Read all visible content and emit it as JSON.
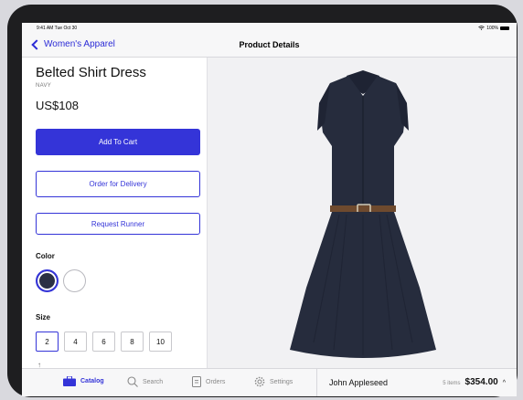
{
  "status": {
    "time": "9:41 AM  Tue Oct 30",
    "battery": "100%"
  },
  "nav": {
    "back_label": "Women's Apparel",
    "title": "Product Details"
  },
  "product": {
    "name": "Belted Shirt Dress",
    "variant": "NAVY",
    "price": "US$108",
    "actions": {
      "add_to_cart": "Add To Cart",
      "delivery": "Order for Delivery",
      "runner": "Request Runner"
    },
    "color_label": "Color",
    "colors": [
      {
        "name": "navy",
        "hex": "#2b3044",
        "selected": true
      },
      {
        "name": "white",
        "hex": "#ffffff",
        "selected": false
      }
    ],
    "size_label": "Size",
    "sizes": [
      "2",
      "4",
      "6",
      "8",
      "10"
    ],
    "selected_size": "2"
  },
  "gallery": {
    "image_icon": "dress-image",
    "pages": 2,
    "current_page": 1
  },
  "tabs": [
    {
      "label": "Catalog",
      "icon": "briefcase-icon",
      "active": true
    },
    {
      "label": "Search",
      "icon": "search-icon",
      "active": false
    },
    {
      "label": "Orders",
      "icon": "document-icon",
      "active": false
    },
    {
      "label": "Settings",
      "icon": "gear-icon",
      "active": false
    }
  ],
  "cart": {
    "customer": "John Appleseed",
    "items_count": "5 items",
    "total": "$354.00"
  },
  "colors": {
    "accent": "#3434d8",
    "dress": "#262c3d",
    "belt": "#6e4a2e"
  }
}
